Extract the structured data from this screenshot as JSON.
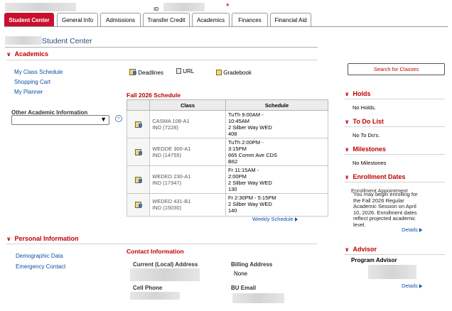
{
  "header": {
    "id_label": "ID",
    "required_mark": "*"
  },
  "tabs": [
    {
      "label": "Student Center"
    },
    {
      "label": "General Info"
    },
    {
      "label": "Admissions"
    },
    {
      "label": "Transfer Credit"
    },
    {
      "label": "Academics"
    },
    {
      "label": "Finances"
    },
    {
      "label": "Financial Aid"
    }
  ],
  "page_title": "Student Center",
  "academics": {
    "heading": "Academics",
    "links": [
      "My Class Schedule",
      "Shopping Cart",
      "My Planner"
    ],
    "other_label": "Other Academic Information",
    "other_value": "",
    "quicklinks": [
      "Deadlines",
      "URL",
      "Gradebook"
    ],
    "schedule_title": "Fall 2026 Schedule",
    "table_headers": [
      "Class",
      "Schedule"
    ],
    "rows": [
      {
        "course": "CASMA 108-A1",
        "section": "IND (7228)",
        "schedule": [
          "TuTh 9:00AM -",
          "10:45AM",
          "2 Silber Way WED",
          "408"
        ]
      },
      {
        "course": "WEDDE 300-A1",
        "section": "IND (14755)",
        "schedule": [
          "TuTh 2:00PM -",
          "3:15PM",
          "665 Comm Ave CDS",
          "B62"
        ]
      },
      {
        "course": "WEDED 230-A1",
        "section": "IND (17347)",
        "schedule": [
          "Fr 11:15AM -",
          "2:00PM",
          "2 Silber Way WED",
          "130"
        ]
      },
      {
        "course": "WEDED 431-B1",
        "section": "IND (15030)",
        "schedule": [
          "Fr 2:30PM - 5:15PM",
          "2 Silber Way WED",
          "140"
        ]
      }
    ],
    "weekly_link": "Weekly Schedule"
  },
  "search_button": "Search for Classes",
  "holds": {
    "heading": "Holds",
    "text": "No Holds."
  },
  "todo": {
    "heading": "To Do List",
    "text": "No To Do's."
  },
  "milestones": {
    "heading": "Milestones",
    "text": "No Milestones"
  },
  "enrollment": {
    "heading": "Enrollment Dates",
    "title": "Enrollment Appointment",
    "text": "You may begin enrolling for the Fall 2026 Regular Academic Session on April 10, 2026. Enrollment dates reflect projected academic level.",
    "details": "Details"
  },
  "personal": {
    "heading": "Personal Information",
    "links": [
      "Demographic Data",
      "Emergency Contact"
    ],
    "contact_title": "Contact Information",
    "current_address_label": "Current (Local) Address",
    "billing_label": "Billing Address",
    "billing_value": "None",
    "cell_label": "Cell Phone",
    "email_label": "BU Email"
  },
  "advisor": {
    "heading": "Advisor",
    "program_label": "Program Advisor",
    "details": "Details"
  }
}
